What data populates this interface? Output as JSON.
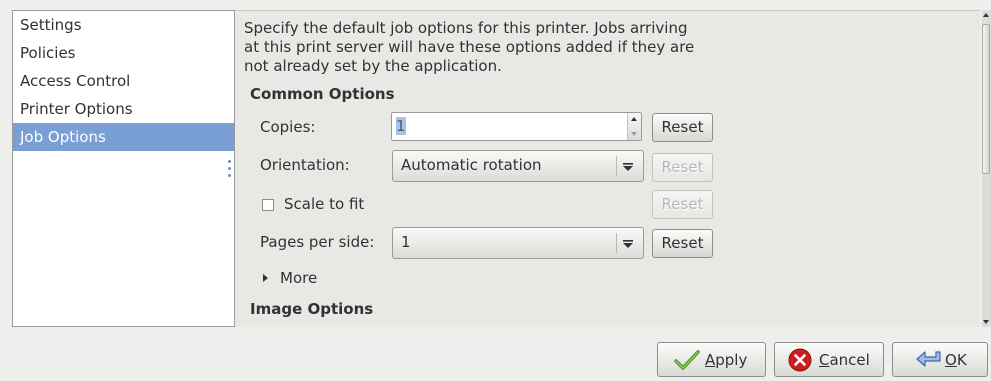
{
  "sidebar": {
    "items": [
      {
        "label": "Settings",
        "selected": false
      },
      {
        "label": "Policies",
        "selected": false
      },
      {
        "label": "Access Control",
        "selected": false
      },
      {
        "label": "Printer Options",
        "selected": false
      },
      {
        "label": "Job Options",
        "selected": true
      }
    ]
  },
  "description": "Specify the default job options for this printer.  Jobs arriving at this print server will have these options added if they are not already set by the application.",
  "common_options": {
    "heading": "Common Options",
    "copies": {
      "label": "Copies:",
      "value": "1",
      "reset_label": "Reset",
      "reset_enabled": true
    },
    "orientation": {
      "label": "Orientation:",
      "value": "Automatic rotation",
      "reset_label": "Reset",
      "reset_enabled": false
    },
    "scale_to_fit": {
      "label": "Scale to fit",
      "checked": false,
      "reset_label": "Reset",
      "reset_enabled": false
    },
    "pages_per_side": {
      "label": "Pages per side:",
      "value": "1",
      "reset_label": "Reset",
      "reset_enabled": true
    },
    "more_label": "More"
  },
  "image_options": {
    "heading": "Image Options"
  },
  "dialog_buttons": {
    "apply": {
      "prefix": "",
      "mnemonic": "A",
      "rest": "pply",
      "icon": "checkmark-icon"
    },
    "cancel": {
      "prefix": "",
      "mnemonic": "C",
      "rest": "ancel",
      "icon": "cancel-icon"
    },
    "ok": {
      "prefix": "",
      "mnemonic": "O",
      "rest": "K",
      "icon": "return-arrow-icon"
    }
  },
  "colors": {
    "selection": "#7a9fd4",
    "window_bg": "#eeeeec",
    "cancel_red": "#cc1f1f",
    "apply_green": "#5fa030"
  }
}
